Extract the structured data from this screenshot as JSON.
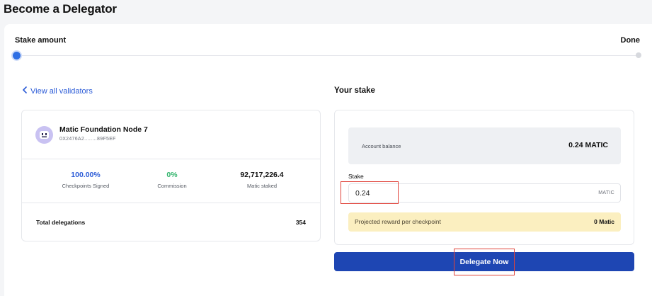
{
  "page": {
    "title": "Become a Delegator"
  },
  "stepper": {
    "steps": [
      {
        "label": "Stake amount",
        "active": true
      },
      {
        "label": "Done",
        "active": false
      }
    ]
  },
  "back_link": {
    "label": "View all validators",
    "icon": "chevron-left-icon"
  },
  "validator": {
    "name": "Matic Foundation Node 7",
    "address": "0X2476A2........89F5EF",
    "avatar_icon": "robot-avatar-icon",
    "stats": [
      {
        "value": "100.00%",
        "label": "Checkpoints Signed",
        "color": "#2b5bd7"
      },
      {
        "value": "0%",
        "label": "Commission",
        "color": "#2fb36a"
      },
      {
        "value": "92,717,226.4",
        "label": "Matic staked",
        "color": "#111111"
      }
    ],
    "total_delegations_label": "Total delegations",
    "total_delegations_value": "354"
  },
  "stake": {
    "title": "Your stake",
    "account_balance_label": "Account balance",
    "account_balance_value": "0.24 MATIC",
    "stake_label": "Stake",
    "stake_value": "0.24",
    "stake_unit": "MATIC",
    "projected_reward_label": "Projected reward per checkpoint",
    "projected_reward_value": "0 Matic"
  },
  "delegate_button": {
    "label": "Delegate Now"
  },
  "colors": {
    "accent": "#1e46b3",
    "link": "#2b5bd7",
    "highlight_box": "#e0433a",
    "reward_background": "#fbefc0"
  }
}
